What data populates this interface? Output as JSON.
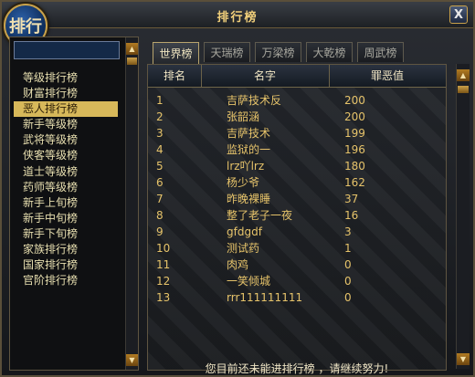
{
  "window": {
    "title": "排行榜",
    "badge": "排行",
    "close_label": "X"
  },
  "sidebar": {
    "items": [
      {
        "label": "等级排行榜"
      },
      {
        "label": "财富排行榜"
      },
      {
        "label": "恶人排行榜"
      },
      {
        "label": "新手等级榜"
      },
      {
        "label": "武将等级榜"
      },
      {
        "label": "侠客等级榜"
      },
      {
        "label": "道士等级榜"
      },
      {
        "label": "药师等级榜"
      },
      {
        "label": "新手上旬榜"
      },
      {
        "label": "新手中旬榜"
      },
      {
        "label": "新手下旬榜"
      },
      {
        "label": "家族排行榜"
      },
      {
        "label": "国家排行榜"
      },
      {
        "label": "官阶排行榜"
      }
    ],
    "selected_index": 2
  },
  "tabs": [
    {
      "label": "世界榜"
    },
    {
      "label": "天瑞榜"
    },
    {
      "label": "万梁榜"
    },
    {
      "label": "大乾榜"
    },
    {
      "label": "周武榜"
    }
  ],
  "table": {
    "headers": {
      "rank": "排名",
      "name": "名字",
      "value": "罪恶值"
    },
    "rows": [
      {
        "rank": "1",
        "name": "吉萨技术反",
        "value": "200"
      },
      {
        "rank": "2",
        "name": "张韶涵",
        "value": "200"
      },
      {
        "rank": "3",
        "name": "吉萨技术",
        "value": "199"
      },
      {
        "rank": "4",
        "name": "监狱的一",
        "value": "196"
      },
      {
        "rank": "5",
        "name": "lrz吖lrz",
        "value": "180"
      },
      {
        "rank": "6",
        "name": "杨少爷",
        "value": "162"
      },
      {
        "rank": "7",
        "name": "昨晚裸睡",
        "value": "37"
      },
      {
        "rank": "8",
        "name": "整了老子一夜",
        "value": "16"
      },
      {
        "rank": "9",
        "name": "gfdgdf",
        "value": "3"
      },
      {
        "rank": "10",
        "name": "测试药",
        "value": "1"
      },
      {
        "rank": "11",
        "name": "肉鸡",
        "value": "0"
      },
      {
        "rank": "12",
        "name": "一笑倾城",
        "value": "0"
      },
      {
        "rank": "13",
        "name": "rrr111111111",
        "value": "0"
      }
    ]
  },
  "footer": {
    "note": "您目前还未能进排行榜 ，请继续努力!"
  },
  "colors": {
    "accent_gold": "#d7b85a",
    "row_text": "#e6c36a",
    "title_text": "#f2d07b"
  }
}
